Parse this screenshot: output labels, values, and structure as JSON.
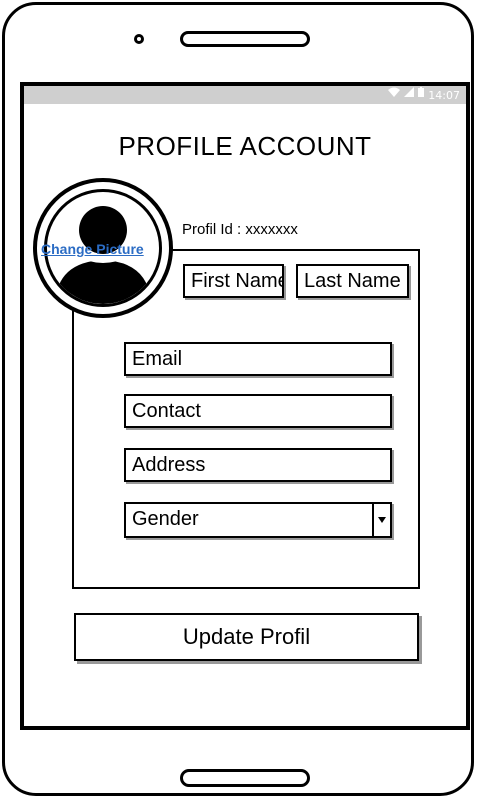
{
  "status_bar": {
    "time": "14:07",
    "icons": [
      "wifi-icon",
      "signal-icon",
      "battery-icon"
    ]
  },
  "page": {
    "title": "PROFILE ACCOUNT",
    "profile_id": "Profil Id : xxxxxxx"
  },
  "avatar": {
    "change_label": "Change Picture"
  },
  "form": {
    "first_name": "First Name",
    "last_name": "Last Name",
    "email": "Email",
    "contact": "Contact",
    "address": "Address",
    "gender": "Gender"
  },
  "actions": {
    "update_label": "Update Profil"
  }
}
